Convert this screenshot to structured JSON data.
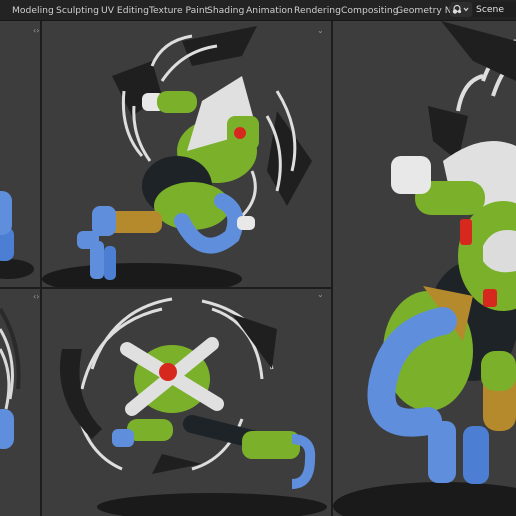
{
  "header": {
    "workspace_tabs": [
      {
        "label": "Modeling"
      },
      {
        "label": "Sculpting"
      },
      {
        "label": "UV Editing"
      },
      {
        "label": "Texture Paint"
      },
      {
        "label": "Shading"
      },
      {
        "label": "Animation"
      },
      {
        "label": "Rendering"
      },
      {
        "label": "Compositing"
      },
      {
        "label": "Geometry Noc"
      }
    ],
    "scene_label": "Scene"
  },
  "icons": {
    "scene_selector": "scene-icon",
    "dropdown": "chevron-down-icon",
    "viewport_split_left": "split-arrows-icon",
    "viewport_expand": "chevron-down-icon"
  },
  "colors": {
    "viewport_bg": "#3d3d3d",
    "header_bg": "#232323",
    "robot_green": "#7bb12a",
    "robot_blue": "#5f8fdc",
    "robot_red": "#d7281e",
    "robot_gold": "#b58a2c"
  }
}
